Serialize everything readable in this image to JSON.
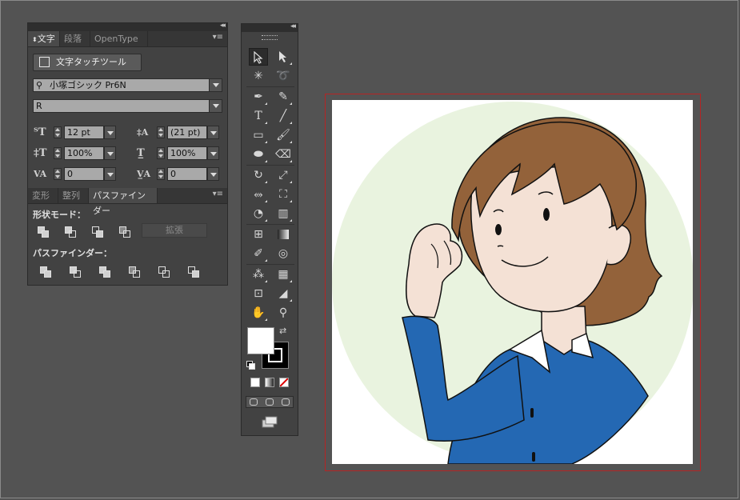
{
  "character_panel": {
    "tabs": [
      "文字",
      "段落",
      "OpenType"
    ],
    "touch_type_button": "文字タッチツール",
    "font_family": "小塚ゴシック Pr6N",
    "font_style": "R",
    "font_size": "12 pt",
    "leading": "(21 pt)",
    "vertical_scale": "100%",
    "horizontal_scale": "100%",
    "kerning": "0",
    "tracking": "0"
  },
  "pathfinder_panel": {
    "tabs": [
      "変形",
      "整列",
      "パスファインダー"
    ],
    "shape_modes_label": "形状モード：",
    "expand_button": "拡張",
    "pathfinders_label": "パスファインダー：",
    "shape_mode_icons": [
      "unite-icon",
      "minus-front-icon",
      "intersect-icon",
      "exclude-icon"
    ],
    "pathfinder_icons": [
      "divide-icon",
      "trim-icon",
      "merge-icon",
      "crop-icon",
      "outline-icon",
      "minus-back-icon"
    ]
  },
  "tools_panel": {
    "tools": [
      [
        "selection-tool",
        "direct-selection-tool"
      ],
      [
        "magic-wand-tool",
        "lasso-tool"
      ],
      [
        "pen-tool",
        "curvature-pen-tool"
      ],
      [
        "type-tool",
        "line-segment-tool"
      ],
      [
        "rectangle-tool",
        "paintbrush-tool"
      ],
      [
        "blob-brush-tool",
        "eraser-tool"
      ],
      [
        "rotate-tool",
        "scale-tool"
      ],
      [
        "width-tool",
        "free-transform-tool"
      ],
      [
        "shape-builder-tool",
        "perspective-grid-tool"
      ],
      [
        "mesh-tool",
        "gradient-tool"
      ],
      [
        "eyedropper-tool",
        "blend-tool"
      ],
      [
        "symbol-sprayer-tool",
        "column-graph-tool"
      ],
      [
        "artboard-tool",
        "slice-tool"
      ],
      [
        "hand-tool",
        "zoom-tool"
      ]
    ],
    "fill_color": "#ffffff",
    "stroke_color": "#000000"
  },
  "artwork": {
    "background_circle": "#e9f3df",
    "hair": "#93623a",
    "skin": "#f4e1d5",
    "shirt": "#2468b3",
    "collar": "#ffffff",
    "artboard_border": "#b52424"
  }
}
